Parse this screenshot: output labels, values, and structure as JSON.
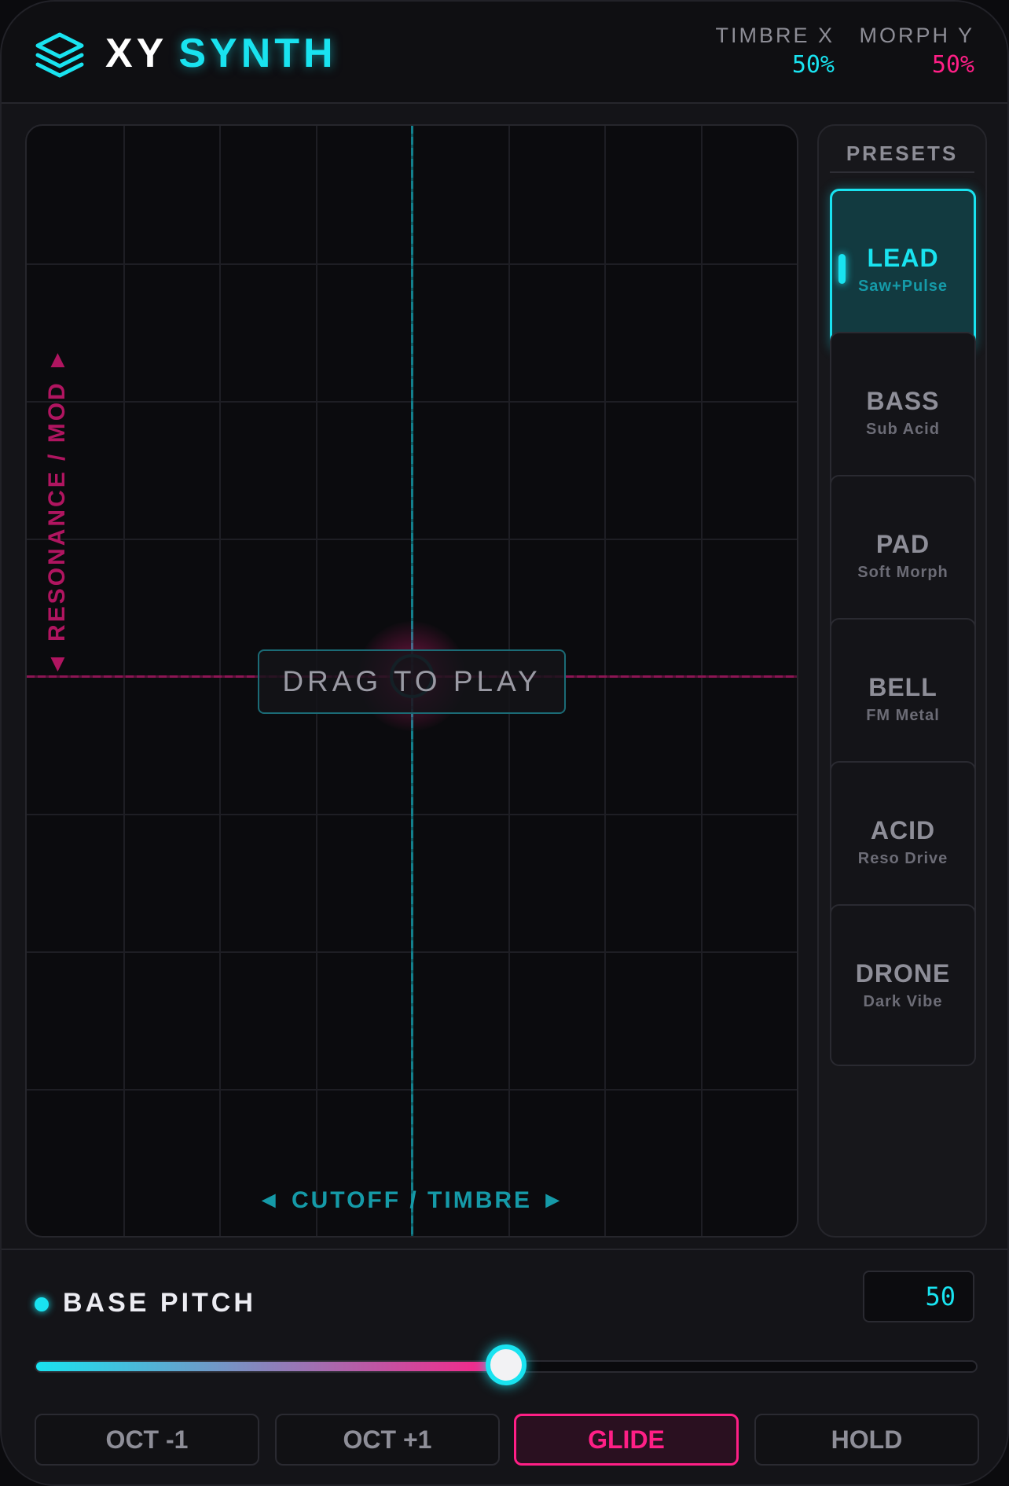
{
  "app": {
    "title_part1": "XY",
    "title_part2": "SYNTH",
    "logo_icon": "layers-icon"
  },
  "readouts": {
    "x": {
      "label": "TIMBRE X",
      "value": "50%"
    },
    "y": {
      "label": "MORPH Y",
      "value": "50%"
    }
  },
  "pad": {
    "hint": "DRAG TO PLAY",
    "x_axis_label": "◄ CUTOFF / TIMBRE ►",
    "y_axis_label": "◄ RESONANCE / MOD ►",
    "x_position": 0.5,
    "y_position": 0.5
  },
  "presets": {
    "title": "PRESETS",
    "active_index": 0,
    "items": [
      {
        "name": "LEAD",
        "sub": "Saw+Pulse"
      },
      {
        "name": "BASS",
        "sub": "Sub Acid"
      },
      {
        "name": "PAD",
        "sub": "Soft Morph"
      },
      {
        "name": "BELL",
        "sub": "FM Metal"
      },
      {
        "name": "ACID",
        "sub": "Reso Drive"
      },
      {
        "name": "DRONE",
        "sub": "Dark Vibe"
      }
    ]
  },
  "pitch": {
    "label": "BASE PITCH",
    "value": "50",
    "level": 0.5
  },
  "buttons": [
    {
      "label": "OCT -1",
      "active": false
    },
    {
      "label": "OCT +1",
      "active": false
    },
    {
      "label": "GLIDE",
      "active": true
    },
    {
      "label": "HOLD",
      "active": false
    }
  ],
  "colors": {
    "accent_cyan": "#19e3f0",
    "accent_pink": "#ff1f86",
    "background": "#141418"
  }
}
